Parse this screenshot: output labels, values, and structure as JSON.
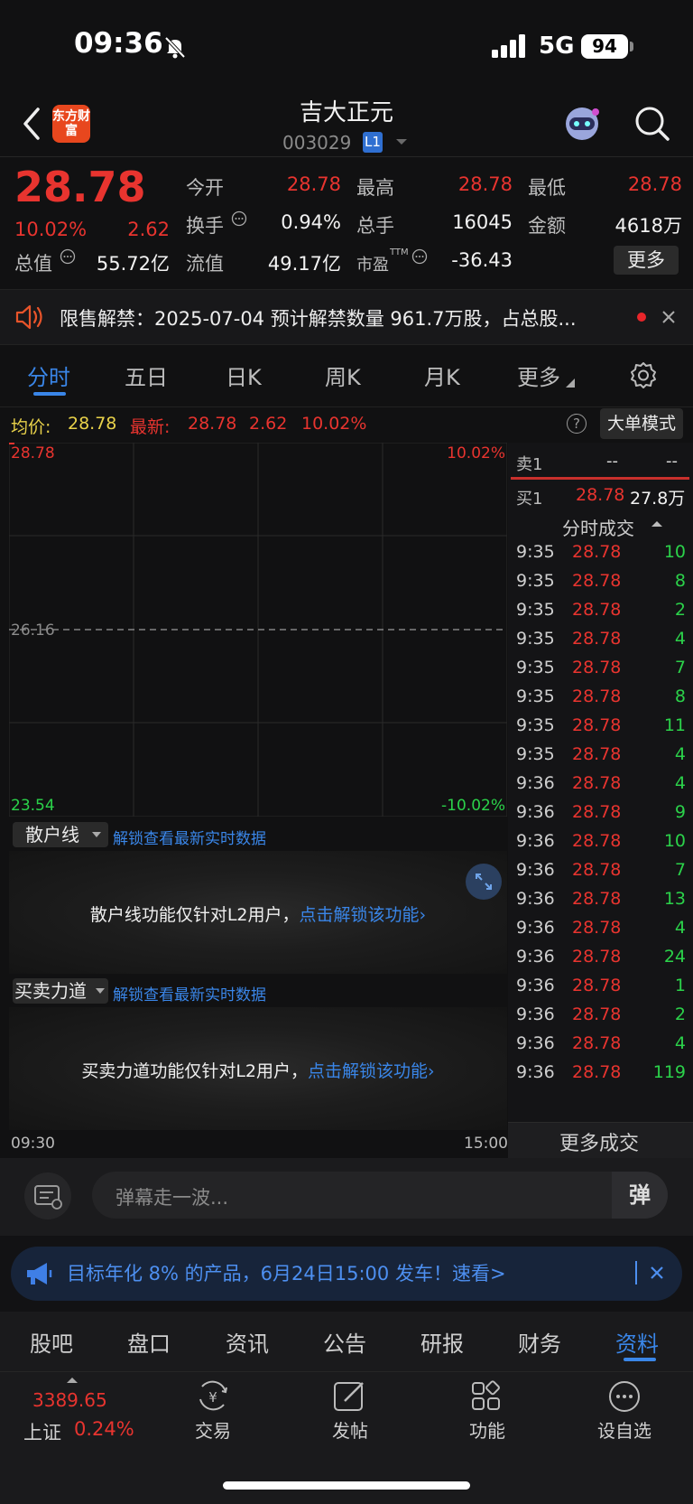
{
  "status_bar": {
    "time": "09:36",
    "network": "5G",
    "battery": "94"
  },
  "header": {
    "logo_text": "东方财富",
    "stock_name": "吉大正元",
    "stock_code": "003029",
    "level_badge": "L1"
  },
  "quote": {
    "price": "28.78",
    "change_pct": "10.02%",
    "change": "2.62",
    "fields": {
      "open_label": "今开",
      "open": "28.78",
      "high_label": "最高",
      "high": "28.78",
      "low_label": "最低",
      "low": "28.78",
      "turnover_label": "换手",
      "turnover": "0.94%",
      "volume_label": "总手",
      "volume": "16045",
      "amount_label": "金额",
      "amount": "4618万",
      "mktcap_label": "总值",
      "mktcap": "55.72亿",
      "float_label": "流值",
      "float": "49.17亿",
      "pe_label": "市盈",
      "pe_sup": "TTM",
      "pe": "-36.43"
    },
    "more_button": "更多"
  },
  "notice": {
    "text": "限售解禁：2025-07-04 预计解禁数量 961.7万股，占总股..."
  },
  "chart_tabs": {
    "items": [
      "分时",
      "五日",
      "日K",
      "周K",
      "月K",
      "更多"
    ],
    "active": "分时"
  },
  "chart_header": {
    "avg_label": "均价:",
    "avg": "28.78",
    "latest_label": "最新:",
    "latest": "28.78",
    "latest_change": "2.62",
    "latest_pct": "10.02%",
    "help": "?",
    "big_order_button": "大单模式"
  },
  "intraday_chart": {
    "y_top": "28.78",
    "y_mid": "26.16",
    "y_bottom": "23.54",
    "pct_top": "10.02%",
    "pct_bottom": "-10.02%",
    "x_start": "09:30",
    "x_end": "15:00"
  },
  "retail_panel": {
    "selector": "散户线",
    "unlock_link": "解锁查看最新实时数据",
    "message": "散户线功能仅针对L2用户，",
    "message_link": "点击解锁该功能"
  },
  "force_panel": {
    "selector": "买卖力道",
    "unlock_link": "解锁查看最新实时数据",
    "message": "买卖力道功能仅针对L2用户，",
    "message_link": "点击解锁该功能"
  },
  "order_book": {
    "sell1_label": "卖1",
    "sell1_price": "--",
    "sell1_vol": "--",
    "buy1_label": "买1",
    "buy1_price": "28.78",
    "buy1_vol": "27.8万",
    "ticks_title": "分时成交",
    "ticks": [
      {
        "t": "9:35",
        "p": "28.78",
        "v": "10"
      },
      {
        "t": "9:35",
        "p": "28.78",
        "v": "8"
      },
      {
        "t": "9:35",
        "p": "28.78",
        "v": "2"
      },
      {
        "t": "9:35",
        "p": "28.78",
        "v": "4"
      },
      {
        "t": "9:35",
        "p": "28.78",
        "v": "7"
      },
      {
        "t": "9:35",
        "p": "28.78",
        "v": "8"
      },
      {
        "t": "9:35",
        "p": "28.78",
        "v": "11"
      },
      {
        "t": "9:35",
        "p": "28.78",
        "v": "4"
      },
      {
        "t": "9:36",
        "p": "28.78",
        "v": "4"
      },
      {
        "t": "9:36",
        "p": "28.78",
        "v": "9"
      },
      {
        "t": "9:36",
        "p": "28.78",
        "v": "10"
      },
      {
        "t": "9:36",
        "p": "28.78",
        "v": "7"
      },
      {
        "t": "9:36",
        "p": "28.78",
        "v": "13"
      },
      {
        "t": "9:36",
        "p": "28.78",
        "v": "4"
      },
      {
        "t": "9:36",
        "p": "28.78",
        "v": "24"
      },
      {
        "t": "9:36",
        "p": "28.78",
        "v": "1"
      },
      {
        "t": "9:36",
        "p": "28.78",
        "v": "2"
      },
      {
        "t": "9:36",
        "p": "28.78",
        "v": "4"
      },
      {
        "t": "9:36",
        "p": "28.78",
        "v": "119"
      }
    ],
    "more_trades": "更多成交"
  },
  "comment_bar": {
    "placeholder": "弹幕走一波...",
    "danmu_button": "弹"
  },
  "promo": {
    "text": "目标年化 8% 的产品，6月24日15:00 发车！",
    "link": "速看>"
  },
  "section_tabs": {
    "items": [
      "股吧",
      "盘口",
      "资讯",
      "公告",
      "研报",
      "财务",
      "资料"
    ],
    "active": "资料"
  },
  "bottom_nav": {
    "index_value": "3389.65",
    "index_name": "上证",
    "index_pct": "0.24%",
    "items": [
      "交易",
      "发帖",
      "功能",
      "设自选"
    ]
  }
}
